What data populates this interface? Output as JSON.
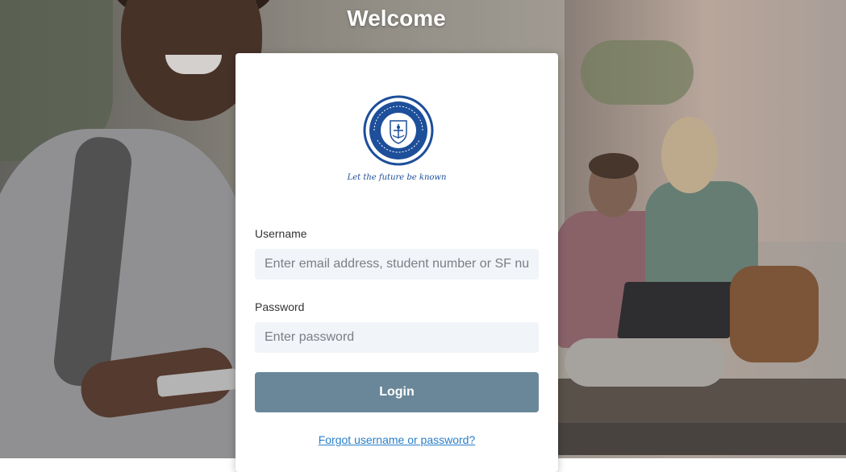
{
  "page": {
    "heading": "Welcome"
  },
  "brand": {
    "logo_icon": "college-crest-icon",
    "tagline": "Let the future be known",
    "accent_color": "#1d4f9a"
  },
  "form": {
    "username_label": "Username",
    "username_placeholder": "Enter email address, student number or SF number",
    "username_value": "",
    "password_label": "Password",
    "password_placeholder": "Enter password",
    "password_value": "",
    "login_label": "Login",
    "login_color": "#6a8799",
    "forgot_link": "Forgot username or password?"
  }
}
